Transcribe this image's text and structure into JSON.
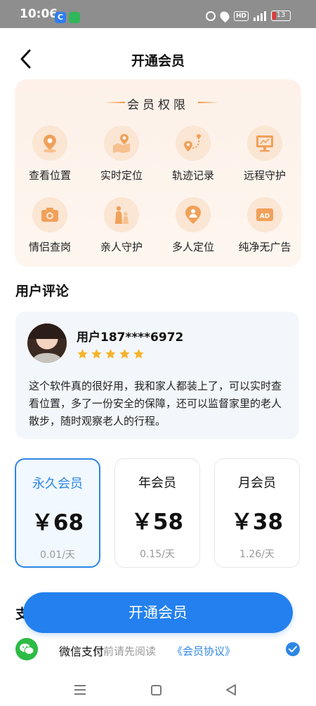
{
  "status_bar": {
    "time": "10:06",
    "app_icon_a": "C",
    "hd_label": "HD",
    "battery_level": "13",
    "battery_color": "#e53935"
  },
  "nav": {
    "title": "开通会员",
    "back_icon": "chevron-left-icon"
  },
  "privileges": {
    "title": "会员权限",
    "accent_color": "#f0963c",
    "items": [
      {
        "label": "查看位置",
        "icon": "location-pin-icon"
      },
      {
        "label": "实时定位",
        "icon": "map-location-icon"
      },
      {
        "label": "轨迹记录",
        "icon": "route-icon"
      },
      {
        "label": "远程守护",
        "icon": "monitor-icon"
      },
      {
        "label": "情侣查岗",
        "icon": "camera-icon"
      },
      {
        "label": "亲人守护",
        "icon": "family-icon"
      },
      {
        "label": "多人定位",
        "icon": "group-location-icon"
      },
      {
        "label": "纯净无广告",
        "icon": "ad-free-icon"
      }
    ]
  },
  "reviews": {
    "section_title": "用户评论",
    "user": "用户187****6972",
    "stars": 5,
    "text": "这个软件真的很好用，我和家人都装上了，可以实时查 看位置，多了一份安全的保障，还可以监督家里的老人 散步，随时观察老人的行程。"
  },
  "plans": [
    {
      "name": "永久会员",
      "price": "￥68",
      "per_day": "0.01/天",
      "selected": true
    },
    {
      "name": "年会员",
      "price": "￥58",
      "per_day": "0.15/天",
      "selected": false
    },
    {
      "name": "月会员",
      "price": "￥38",
      "per_day": "1.26/天",
      "selected": false
    }
  ],
  "payment": {
    "section_title_partial": "支",
    "method_label": "微信支付",
    "agreement_prefix": "员前请先阅读",
    "agreement_link": "《会员协议》",
    "agreed": true,
    "wechat_color": "#2dbb45"
  },
  "cta": {
    "label": "开通会员",
    "color": "#2380ee"
  }
}
